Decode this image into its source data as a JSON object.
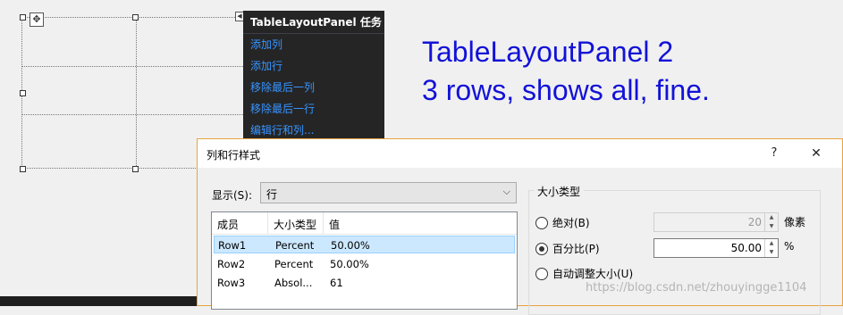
{
  "task_panel": {
    "title": "TableLayoutPanel 任务",
    "links": [
      "添加列",
      "添加行",
      "移除最后一列",
      "移除最后一行",
      "编辑行和列..."
    ]
  },
  "annotation": {
    "line1": "TableLayoutPanel 2",
    "line2": "3 rows,  shows all, fine."
  },
  "dialog": {
    "title": "列和行样式",
    "help_label": "?",
    "close_label": "✕",
    "show_label": "显示(S):",
    "show_value": "行",
    "columns": [
      "成员",
      "大小类型",
      "值"
    ],
    "rows": [
      {
        "member": "Row1",
        "size_type": "Percent",
        "value": "50.00%",
        "selected": true
      },
      {
        "member": "Row2",
        "size_type": "Percent",
        "value": "50.00%",
        "selected": false
      },
      {
        "member": "Row3",
        "size_type": "Absol...",
        "value": "61",
        "selected": false
      }
    ],
    "size_type_group": "大小类型",
    "absolute": {
      "label": "绝对(B)",
      "value": "20",
      "unit": "像素",
      "checked": false
    },
    "percent": {
      "label": "百分比(P)",
      "value": "50.00",
      "unit": "%",
      "checked": true
    },
    "autosize": {
      "label": "自动调整大小(U)",
      "checked": false
    }
  },
  "watermark": "https://blog.csdn.net/zhouyingge1104",
  "icons": {
    "move": "move-icon",
    "smart_tag": "smart-tag-arrow-icon",
    "dropdown": "chevron-down-icon"
  },
  "colors": {
    "annotation": "#1212d8",
    "task_link": "#3794ff",
    "task_bg": "#252526",
    "dialog_border": "#e8a33d",
    "selection": "#cce8ff"
  }
}
